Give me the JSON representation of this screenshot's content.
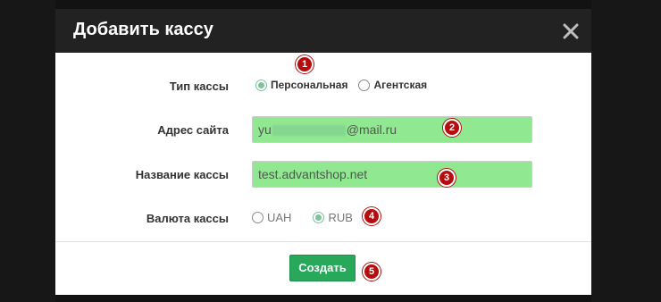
{
  "dialog": {
    "title": "Добавить кассу"
  },
  "form": {
    "cash_type": {
      "label": "Тип кассы",
      "options": [
        {
          "label": "Персональная",
          "selected": true
        },
        {
          "label": "Агентская",
          "selected": false
        }
      ]
    },
    "site_address": {
      "label": "Адрес сайта",
      "value_prefix": "yu",
      "value_suffix": "@mail.ru"
    },
    "cash_name": {
      "label": "Название кассы",
      "value": "test.advantshop.net"
    },
    "currency": {
      "label": "Валюта кассы",
      "options": [
        {
          "label": "UAH",
          "selected": false
        },
        {
          "label": "RUB",
          "selected": true
        }
      ]
    }
  },
  "footer": {
    "create_label": "Создать"
  },
  "annotations": [
    "1",
    "2",
    "3",
    "4",
    "5"
  ],
  "colors": {
    "header_bg": "#222222",
    "input_highlight": "#90e890",
    "create_button": "#27a85a",
    "badge": "#b40d0d",
    "radio_checked": "#7cc49a"
  }
}
